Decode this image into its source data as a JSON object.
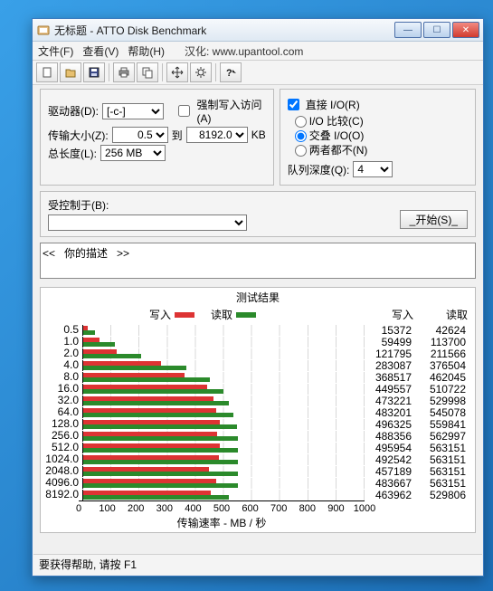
{
  "window": {
    "title": "无标题 - ATTO Disk Benchmark"
  },
  "menu": {
    "file": "文件(F)",
    "view": "查看(V)",
    "help": "帮助(H)",
    "note": "汉化: www.upantool.com"
  },
  "labels": {
    "drive": "驱动器(D):",
    "transfer": "传输大小(Z):",
    "to": "到",
    "kb": "KB",
    "length": "总长度(L):",
    "forceWrite": "强制写入访问(A)",
    "directIO": "直接 I/O(R)",
    "ioCompare": "I/O 比较(C)",
    "overlapped": "交叠 I/O(O)",
    "neither": "两者都不(N)",
    "queueDepth": "队列深度(Q):",
    "controlledBy": "受控制于(B):",
    "startBtn": "_开始(S)_",
    "descPlaceholder": "<<   你的描述   >>",
    "resultsTitle": "测试结果",
    "legendWrite": "写入",
    "legendRead": "读取",
    "colWrite": "写入",
    "colRead": "读取",
    "xAxisLabel": "传输速率 - MB / 秒",
    "status": "要获得帮助, 请按 F1"
  },
  "values": {
    "drive": "[-c-]",
    "sizeFrom": "0.5",
    "sizeTo": "8192.0",
    "totalLength": "256 MB",
    "queueDepth": "4",
    "forceWrite": false,
    "directIO": true,
    "ioMode": "overlapped"
  },
  "chart_data": {
    "type": "bar",
    "title": "测试结果",
    "xlabel": "传输速率 - MB / 秒",
    "xlim": [
      0,
      1000
    ],
    "xticks": [
      0,
      100,
      200,
      300,
      400,
      500,
      600,
      700,
      800,
      900,
      1000
    ],
    "series_names": [
      "写入",
      "读取"
    ],
    "categories": [
      "0.5",
      "1.0",
      "2.0",
      "4.0",
      "8.0",
      "16.0",
      "32.0",
      "64.0",
      "128.0",
      "256.0",
      "512.0",
      "1024.0",
      "2048.0",
      "4096.0",
      "8192.0"
    ],
    "series": [
      {
        "name": "写入",
        "unit": "KB/s",
        "values": [
          15372,
          59499,
          121795,
          283087,
          368517,
          449557,
          473221,
          483201,
          496325,
          488356,
          495954,
          492542,
          457189,
          483667,
          463962
        ]
      },
      {
        "name": "读取",
        "unit": "KB/s",
        "values": [
          42624,
          113700,
          211566,
          376504,
          462045,
          510722,
          529998,
          545078,
          559841,
          562997,
          563151,
          563151,
          563151,
          563151,
          529806
        ]
      }
    ]
  }
}
